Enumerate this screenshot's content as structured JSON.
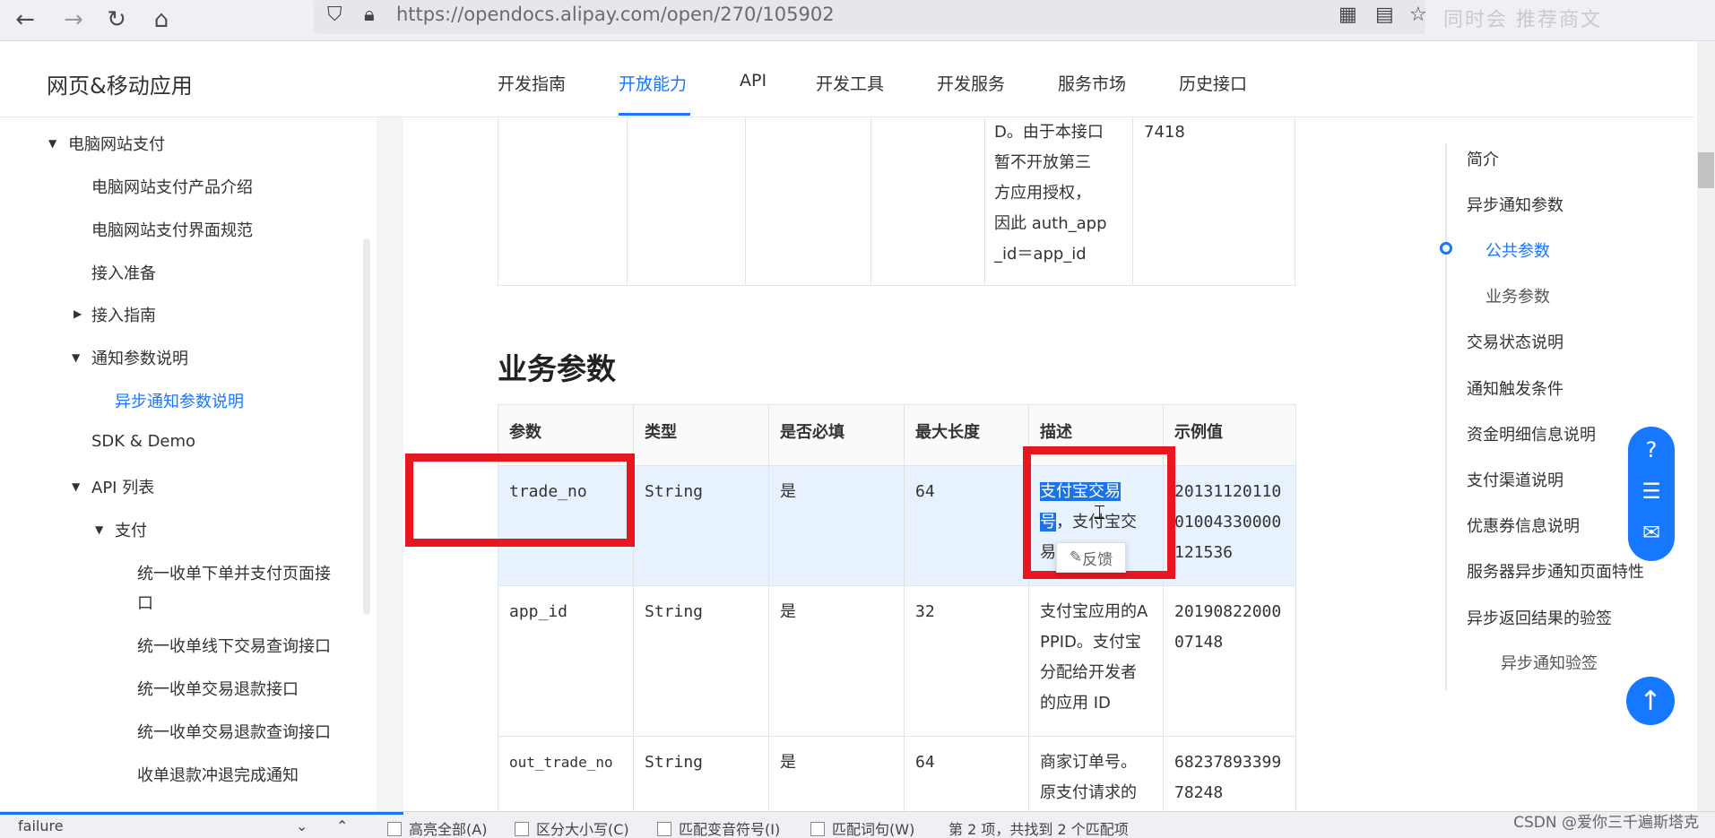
{
  "browser": {
    "url": "https://opendocs.alipay.com/open/270/105902",
    "back_icon": "←",
    "forward_icon": "→",
    "reload_icon": "↻",
    "home_icon": "⌂",
    "faded_text": "同时会 推荐商文"
  },
  "header": {
    "title": "网页&移动应用",
    "nav": [
      "开发指南",
      "开放能力",
      "API",
      "开发工具",
      "开发服务",
      "服务市场",
      "历史接口"
    ],
    "active_nav": "开放能力",
    "accent_color": "#1677ff"
  },
  "sidebar": {
    "items": [
      "电脑网站支付",
      "电脑网站支付产品介绍",
      "电脑网站支付界面规范",
      "接入准备",
      "接入指南",
      "通知参数说明",
      "异步通知参数说明",
      "SDK & Demo",
      "API 列表",
      "支付",
      "统一收单下单并支付页面接",
      "口",
      "统一收单线下交易查询接口",
      "统一收单交易退款接口",
      "统一收单交易退款查询接口",
      "收单退款冲退完成通知"
    ]
  },
  "fragment": {
    "desc_lines": [
      "D。由于本接口",
      "暂不开放第三",
      "方应用授权，",
      "因此 auth_app",
      "_id＝app_id"
    ],
    "example": "7418"
  },
  "section": {
    "title": "业务参数"
  },
  "table": {
    "headers": [
      "参数",
      "类型",
      "是否必填",
      "最大长度",
      "描述",
      "示例值"
    ],
    "rows": [
      {
        "param": "trade_no",
        "type": "String",
        "required": "是",
        "max_len": "64",
        "desc_selected": "支付宝交易号",
        "desc_rest": "，支付宝交易",
        "example": "2013112011001004330000121536"
      },
      {
        "param": "app_id",
        "type": "String",
        "required": "是",
        "max_len": "32",
        "desc": "支付宝应用的APPID。支付宝分配给开发者的应用 ID",
        "example": "2019082200007148"
      },
      {
        "param": "out_trade_no",
        "type": "String",
        "required": "是",
        "max_len": "64",
        "desc": "商家订单号。原支付请求的",
        "example": "6823789339978248"
      }
    ]
  },
  "feedback_label": "反馈",
  "toc": {
    "items": [
      "简介",
      "异步通知参数",
      "公共参数",
      "业务参数",
      "交易状态说明",
      "通知触发条件",
      "资金明细信息说明",
      "支付渠道说明",
      "优惠券信息说明",
      "服务器异步通知页面特性",
      "异步返回结果的验签",
      "异步通知验签"
    ],
    "active": "公共参数"
  },
  "find_bar": {
    "query": "failure",
    "options": [
      "高亮全部(A)",
      "区分大小写(C)",
      "匹配变音符号(I)",
      "匹配词句(W)"
    ],
    "result": "第 2 项，共找到 2 个匹配项"
  },
  "watermark": "CSDN @爱你三千遍斯塔克",
  "highlight_color": "#e8171f"
}
